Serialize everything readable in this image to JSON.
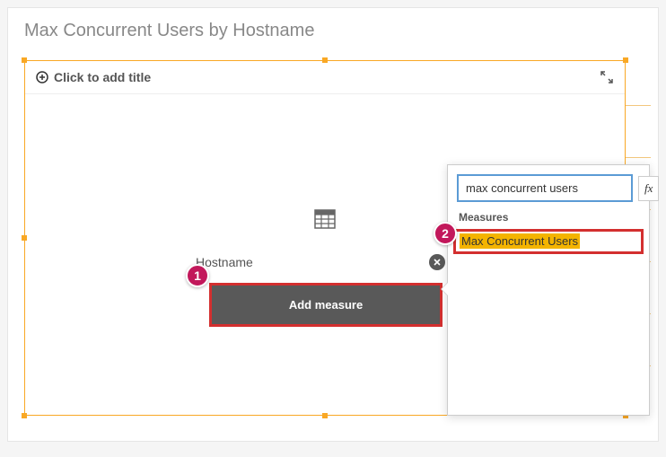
{
  "panel": {
    "title": "Max Concurrent Users by Hostname"
  },
  "vis": {
    "add_title_prompt": "Click to add title",
    "dimension_label": "Hostname",
    "add_measure_label": "Add measure"
  },
  "popover": {
    "search_value": "max concurrent users",
    "fx_label": "fx",
    "section_label": "Measures",
    "measure_option": "Max Concurrent Users"
  },
  "callouts": {
    "one": "1",
    "two": "2"
  }
}
